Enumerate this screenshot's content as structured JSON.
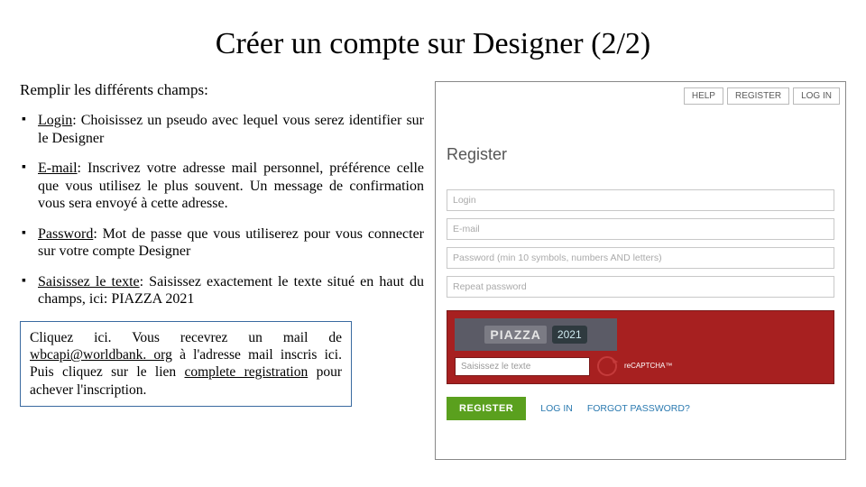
{
  "title": "Créer un compte sur Designer (2/2)",
  "intro": "Remplir les différents champs:",
  "bullets": {
    "login": {
      "label": "Login",
      "text": ": Choisissez un pseudo avec lequel vous serez identifier sur le Designer"
    },
    "email": {
      "label": "E-mail",
      "text": ": Inscrivez votre adresse mail personnel, préférence celle que vous utilisez le plus souvent. Un message de confirmation vous sera envoyé à cette adresse."
    },
    "password": {
      "label": "Password",
      "text": ": Mot de passe que vous utiliserez pour vous connecter sur votre compte Designer"
    },
    "captcha": {
      "label": "Saisissez le texte",
      "text": ": Saisissez exactement le texte situé en haut du champs, ici: PIAZZA 2021"
    }
  },
  "note": {
    "pre": "Cliquez ici. Vous recevrez un mail de ",
    "email_link": "wbcapi@worldbank. org",
    "mid": " à l'adresse mail inscris ici. Puis cliquez sur le lien ",
    "complete_link": "complete registration",
    "post": " pour achever l'inscription."
  },
  "browser": {
    "topbar": {
      "help": "HELP",
      "register": "REGISTER",
      "login": "LOG IN"
    },
    "register_heading": "Register",
    "fields": {
      "login_ph": "Login",
      "email_ph": "E-mail",
      "password_ph": "Password (min 10 symbols, numbers AND letters)",
      "repeat_ph": "Repeat password"
    },
    "captcha": {
      "word": "PIAZZA",
      "year": "2021",
      "input_ph": "Saisissez le texte",
      "recaptcha": "reCAPTCHA™"
    },
    "buttons": {
      "register": "REGISTER",
      "login": "LOG IN",
      "forgot": "FORGOT PASSWORD?"
    }
  }
}
